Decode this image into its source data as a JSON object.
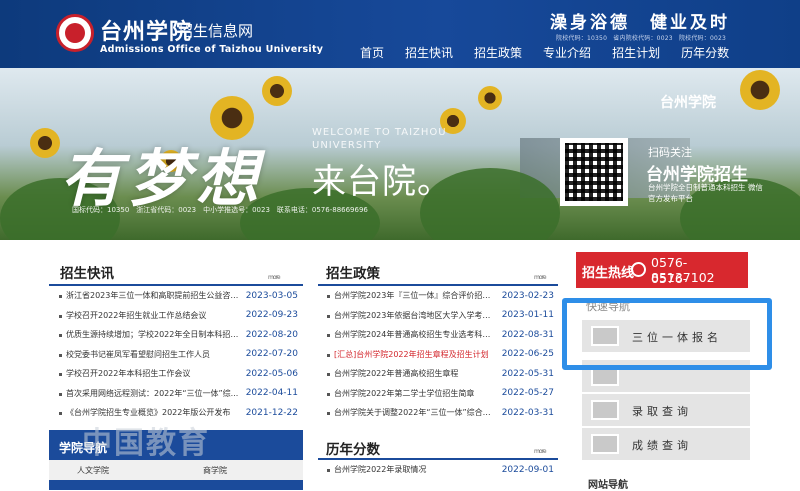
{
  "header": {
    "logo_cn": "台州学院",
    "logo_sub": "招生信息网",
    "logo_en": "Admissions Office of Taizhou University",
    "motto": "澡身浴德　健业及时",
    "codes": "院校代码：10350　省内院校代码：0023　院校代码：0023",
    "nav": [
      "首页",
      "招生快讯",
      "招生政策",
      "专业介绍",
      "招生计划",
      "历年分数"
    ]
  },
  "banner": {
    "calligraphy": "有梦想",
    "welcome": "WELCOME TO TAIZHOU UNIVERSITY",
    "laitai": "来台院。",
    "codes": "国标代码：10350　浙江省代码：0023　中小学推选号：0023　联系电话：0576-88669696",
    "logo": "台州学院",
    "qr_title": "扫码关注",
    "qr_name": "台州学院招生",
    "qr_desc": "台州学院全日制普通本科招生\n微信官方发布平台"
  },
  "news": {
    "title": "招生快讯",
    "more": "more",
    "items": [
      {
        "title": "浙江省2023年三位一体和高职提前招生公益咨询...",
        "date": "2023-03-05"
      },
      {
        "title": "学校召开2022年招生就业工作总结会议",
        "date": "2022-09-23"
      },
      {
        "title": "优质生源持续增加；学校2022年全日制本科招生...",
        "date": "2022-08-20"
      },
      {
        "title": "校党委书记崔凤军看望慰问招生工作人员",
        "date": "2022-07-20"
      },
      {
        "title": "学校召开2022年本科招生工作会议",
        "date": "2022-05-06"
      },
      {
        "title": "首次采用网络远程测试：2022年“三位一体”综...",
        "date": "2022-04-11"
      },
      {
        "title": "《台州学院招生专业概览》2022年版公开发布",
        "date": "2021-12-22"
      }
    ]
  },
  "policy": {
    "title": "招生政策",
    "more": "more",
    "items": [
      {
        "title": "台州学院2023年『三位一体』综合评价招生章程",
        "date": "2023-02-23",
        "red": false
      },
      {
        "title": "台州学院2023年依据台湾地区大学入学考试学科...",
        "date": "2023-01-11",
        "red": false
      },
      {
        "title": "台州学院2024年普通高校招生专业选考科目要求",
        "date": "2022-08-31",
        "red": false
      },
      {
        "title": "[汇总]台州学院2022年招生章程及招生计划",
        "date": "2022-06-25",
        "red": true
      },
      {
        "title": "台州学院2022年普通高校招生章程",
        "date": "2022-05-31",
        "red": false
      },
      {
        "title": "台州学院2022年第二学士学位招生简章",
        "date": "2022-05-27",
        "red": false
      },
      {
        "title": "台州学院关于调整2022年“三位一体”综合评价...",
        "date": "2022-03-31",
        "red": false
      }
    ]
  },
  "scores": {
    "title": "历年分数",
    "more": "more",
    "items": [
      {
        "title": "台州学院2022年录取情况",
        "date": "2022-09-01"
      }
    ]
  },
  "hotline": {
    "label": "招生热线",
    "numbers": [
      "0576-85137102",
      "0576-88669696"
    ]
  },
  "quick": {
    "title": "快速导航",
    "items": [
      {
        "label": "三位一体报名",
        "icon": "monitor-icon"
      },
      {
        "label": "录取查询",
        "icon": "list-icon"
      },
      {
        "label": "成绩查询",
        "icon": "chart-icon"
      }
    ]
  },
  "college": {
    "title": "学院导航",
    "items": [
      "人文学院",
      "商学院"
    ]
  },
  "watermark": "中国教育",
  "footer_peek": "网站导航",
  "colors": {
    "brand_blue": "#1b4b9b",
    "hotline_red": "#d8282e",
    "highlight_blue": "#2e8ee8"
  }
}
